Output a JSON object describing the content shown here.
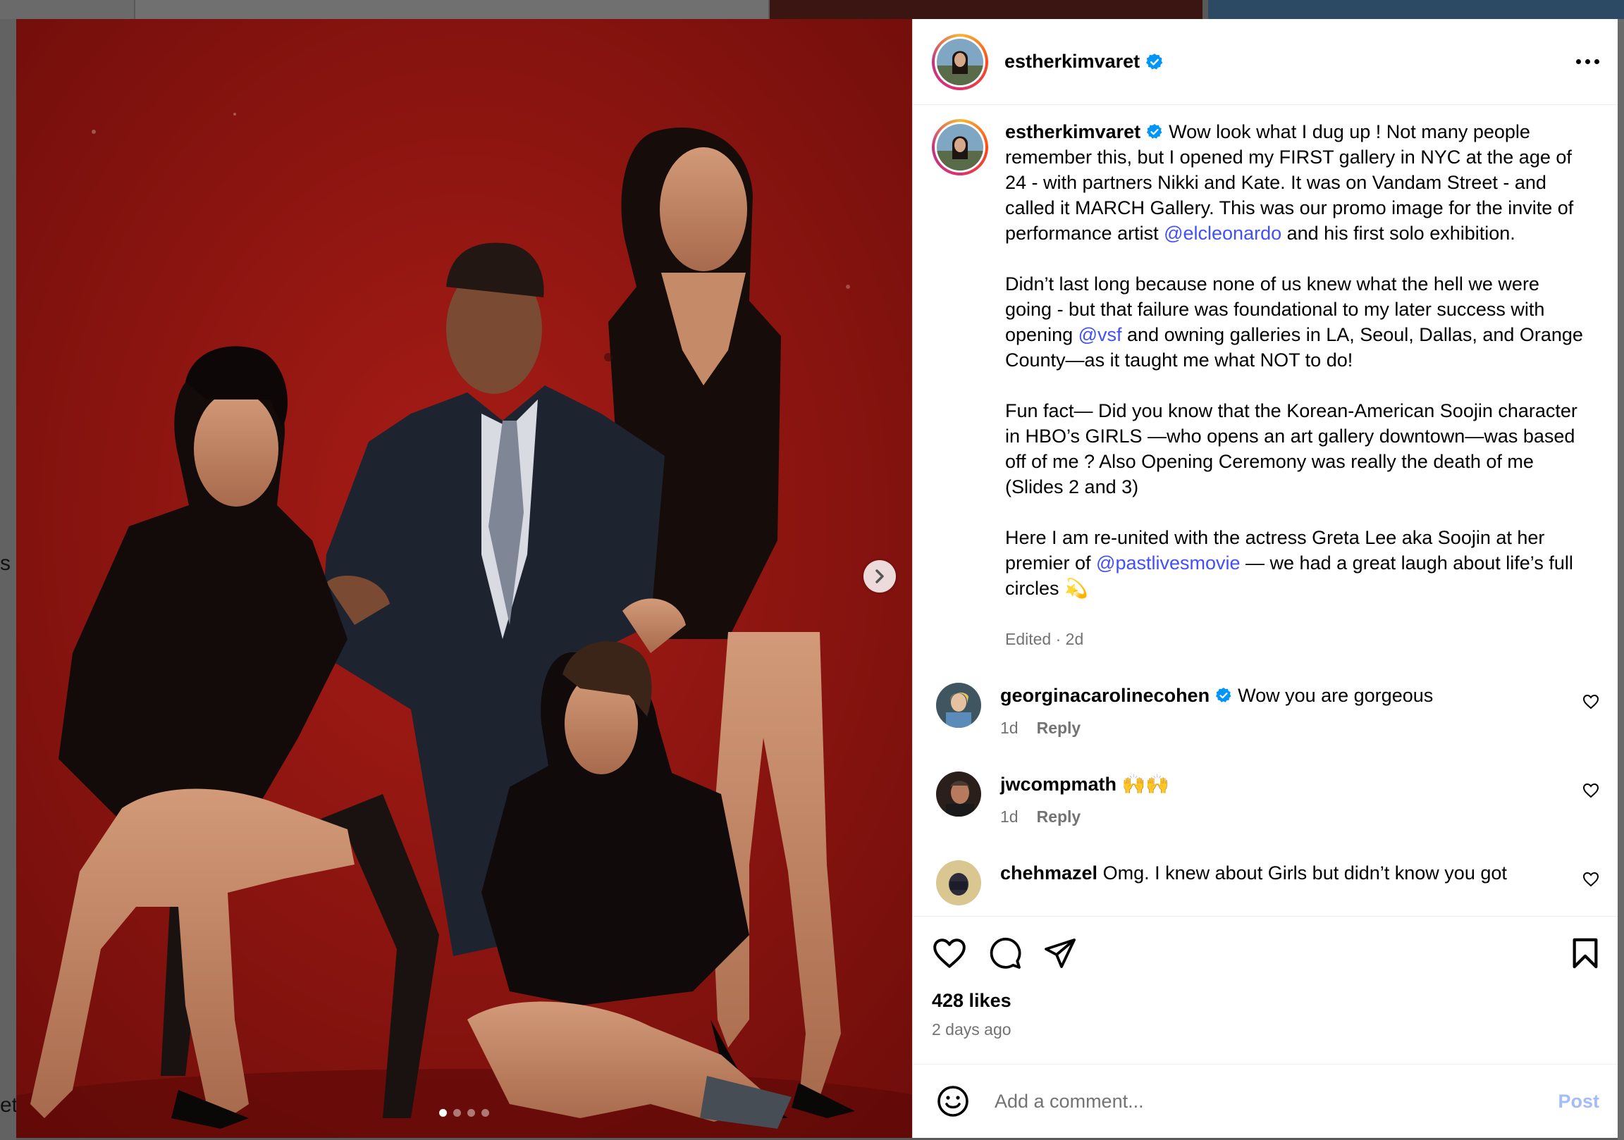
{
  "background": {
    "edge_text_1": "s",
    "edge_text_2": "et"
  },
  "post": {
    "username": "estherkimvaret",
    "verified": true,
    "more_icon": "more-horizontal-icon",
    "media": {
      "slide_count": 4,
      "active_slide": 1,
      "next_icon": "chevron-right-icon"
    },
    "caption": {
      "username": "estherkimvaret",
      "p1_a": "Wow look what I dug up ! Not many people remember this, but I opened my FIRST gallery in NYC at the age of 24 - with partners Nikki and Kate. It was on Vandam Street - and called it MARCH Gallery. This was our promo image for the invite of performance artist ",
      "p1_link": "@elcleonardo",
      "p1_b": " and his first solo exhibition.",
      "p2_a": "Didn’t last long because none of us knew what the hell we were going - but that failure was foundational to my later success with opening ",
      "p2_link": "@vsf",
      "p2_b": " and owning galleries in LA, Seoul, Dallas, and Orange County—as it taught me what NOT to do!",
      "p3": "Fun fact— Did you know that the Korean-American Soojin character in HBO’s GIRLS —who opens an art gallery downtown—was based off of me ? Also Opening Ceremony was really the death of me (Slides 2 and 3)",
      "p4_a": "Here I am re-united with the actress Greta Lee aka Soojin at her premier of ",
      "p4_link": "@pastlivesmovie",
      "p4_b": " — we had a great laugh about life’s full circles 💫",
      "meta": "Edited · 2d"
    },
    "comments": [
      {
        "username": "georginacarolinecohen",
        "verified": true,
        "text": "Wow you are gorgeous",
        "time": "1d",
        "reply": "Reply"
      },
      {
        "username": "jwcompmath",
        "verified": false,
        "text": "🙌🙌",
        "time": "1d",
        "reply": "Reply"
      },
      {
        "username": "chehmazel",
        "verified": false,
        "text": "Omg. I knew about Girls but didn’t know you got",
        "time": "",
        "reply": ""
      }
    ],
    "actions": {
      "like_icon": "heart-icon",
      "comment_icon": "comment-icon",
      "share_icon": "send-icon",
      "save_icon": "bookmark-icon"
    },
    "likes": "428 likes",
    "time_ago": "2 days ago",
    "add_comment": {
      "emoji_icon": "emoji-icon",
      "placeholder": "Add a comment...",
      "post_label": "Post"
    }
  }
}
